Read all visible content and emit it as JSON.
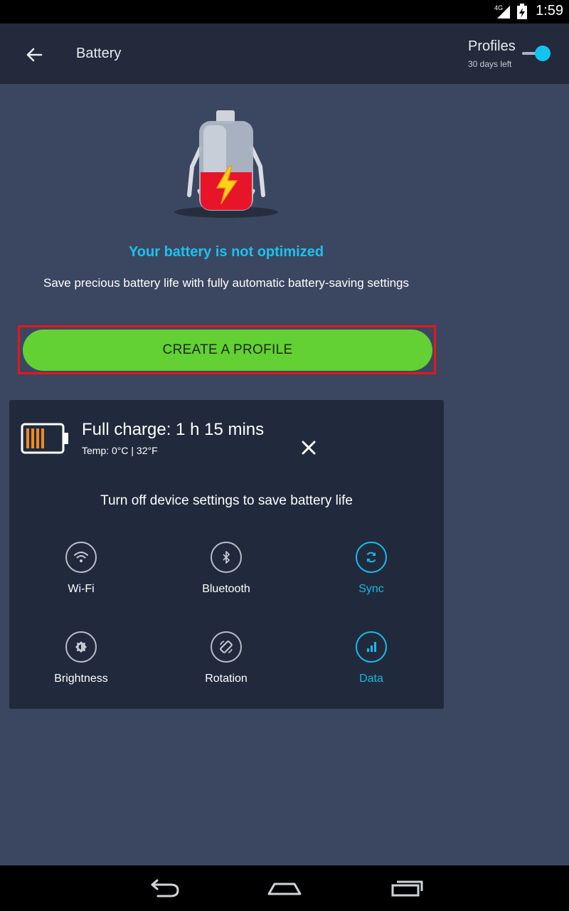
{
  "status_bar": {
    "network": "4G",
    "time": "1:59"
  },
  "app_bar": {
    "title": "Battery",
    "profiles_label": "Profiles",
    "profiles_sub": "30 days left"
  },
  "hero": {
    "headline": "Your battery is not optimized",
    "subline": "Save precious battery life with fully automatic battery-saving settings"
  },
  "cta": {
    "label": "CREATE A PROFILE"
  },
  "card": {
    "charge_title": "Full charge: 1 h 15 mins",
    "temp": "Temp: 0°C | 32°F",
    "subtitle": "Turn off device settings to save battery life",
    "settings": [
      {
        "label": "Wi-Fi",
        "icon": "wifi-icon",
        "active": false
      },
      {
        "label": "Bluetooth",
        "icon": "bluetooth-icon",
        "active": false
      },
      {
        "label": "Sync",
        "icon": "sync-icon",
        "active": true
      },
      {
        "label": "Brightness",
        "icon": "brightness-icon",
        "active": false
      },
      {
        "label": "Rotation",
        "icon": "rotation-icon",
        "active": false
      },
      {
        "label": "Data",
        "icon": "data-icon",
        "active": true
      }
    ]
  },
  "colors": {
    "accent": "#14c4f0",
    "cta_green": "#63d034",
    "highlight_red": "#e8161a",
    "battery_orange": "#f08a1e",
    "battery_red": "#e8142a"
  }
}
